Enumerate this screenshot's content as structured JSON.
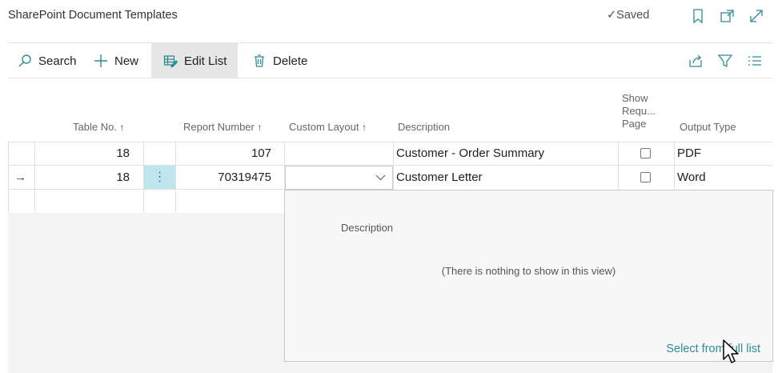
{
  "titlebar": {
    "title": "SharePoint Document Templates",
    "saved_label": "Saved",
    "icons": [
      "bookmark-icon",
      "open-in-new-window-icon",
      "expand-icon"
    ]
  },
  "actions": {
    "search": "Search",
    "new": "New",
    "edit_list": "Edit List",
    "delete": "Delete",
    "right_icons": [
      "share-icon",
      "filter-icon",
      "list-view-icon"
    ]
  },
  "columns": {
    "table_no": "Table No.",
    "report_number": "Report Number",
    "custom_layout": "Custom Layout",
    "description": "Description",
    "show_request_page_line1": "Show",
    "show_request_page_line2": "Requ...",
    "show_request_page_line3": "Page",
    "output_type": "Output Type",
    "sort_glyph": "↑"
  },
  "rows": [
    {
      "table_no": "18",
      "report_number": "107",
      "custom_layout": "",
      "description": "Customer - Order Summary",
      "show_request_page": false,
      "output_type": "PDF",
      "current": false
    },
    {
      "table_no": "18",
      "report_number": "70319475",
      "custom_layout": "",
      "description": "Customer Letter",
      "show_request_page": false,
      "output_type": "Word",
      "current": true
    }
  ],
  "row_marker": "→",
  "row_menu_glyph": "⋮",
  "dropdown": {
    "column_header": "Description",
    "empty_message": "(There is nothing to show in this view)",
    "select_full_list": "Select from full list"
  },
  "colors": {
    "accent": "#2e8c95",
    "selected_cell": "#bfe6ee",
    "active_action": "#e6e6e6"
  }
}
